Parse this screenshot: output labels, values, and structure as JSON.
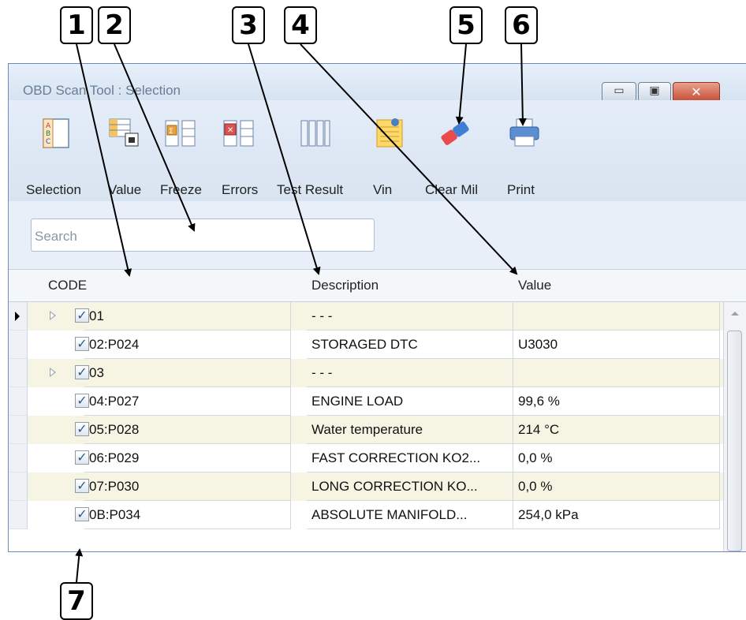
{
  "callouts": [
    "1",
    "2",
    "3",
    "4",
    "5",
    "6",
    "7"
  ],
  "window": {
    "title": "OBD Scan Tool : Selection",
    "min_glyph": "▭",
    "max_glyph": "▣",
    "close_glyph": "✕"
  },
  "toolbar": {
    "items": [
      {
        "label": "Selection",
        "icon": "selection-icon"
      },
      {
        "label": "Value",
        "icon": "value-icon"
      },
      {
        "label": "Freeze",
        "icon": "freeze-icon"
      },
      {
        "label": "Errors",
        "icon": "errors-icon"
      },
      {
        "label": "Test Result",
        "icon": "test-result-icon"
      },
      {
        "label": "Vin",
        "icon": "vin-icon"
      },
      {
        "label": "Clear Mil",
        "icon": "eraser-icon"
      },
      {
        "label": "Print",
        "icon": "printer-icon"
      }
    ]
  },
  "search": {
    "placeholder": "Search"
  },
  "grid": {
    "headers": {
      "code": "CODE",
      "description": "Description",
      "value": "Value"
    },
    "rows": [
      {
        "code": "01",
        "description": "- - -",
        "value": "",
        "expandable": true,
        "current": true,
        "checked": "✓"
      },
      {
        "code": "02:P024",
        "description": "STORAGED DTC",
        "value": "U3030",
        "checked": "✓"
      },
      {
        "code": "03",
        "description": "- - -",
        "value": "",
        "expandable": true,
        "checked": "✓"
      },
      {
        "code": "04:P027",
        "description": "ENGINE LOAD",
        "value": "99,6 %",
        "checked": "✓"
      },
      {
        "code": "05:P028",
        "description": "Water temperature",
        "value": "214 °C",
        "checked": "✓"
      },
      {
        "code": "06:P029",
        "description": "FAST CORRECTION KO2...",
        "value": "0,0 %",
        "checked": "✓"
      },
      {
        "code": "07:P030",
        "description": "LONG CORRECTION KO...",
        "value": "0,0 %",
        "checked": "✓"
      },
      {
        "code": "0B:P034",
        "description": "ABSOLUTE MANIFOLD...",
        "value": "254,0 kPa",
        "checked": "✓"
      }
    ]
  }
}
